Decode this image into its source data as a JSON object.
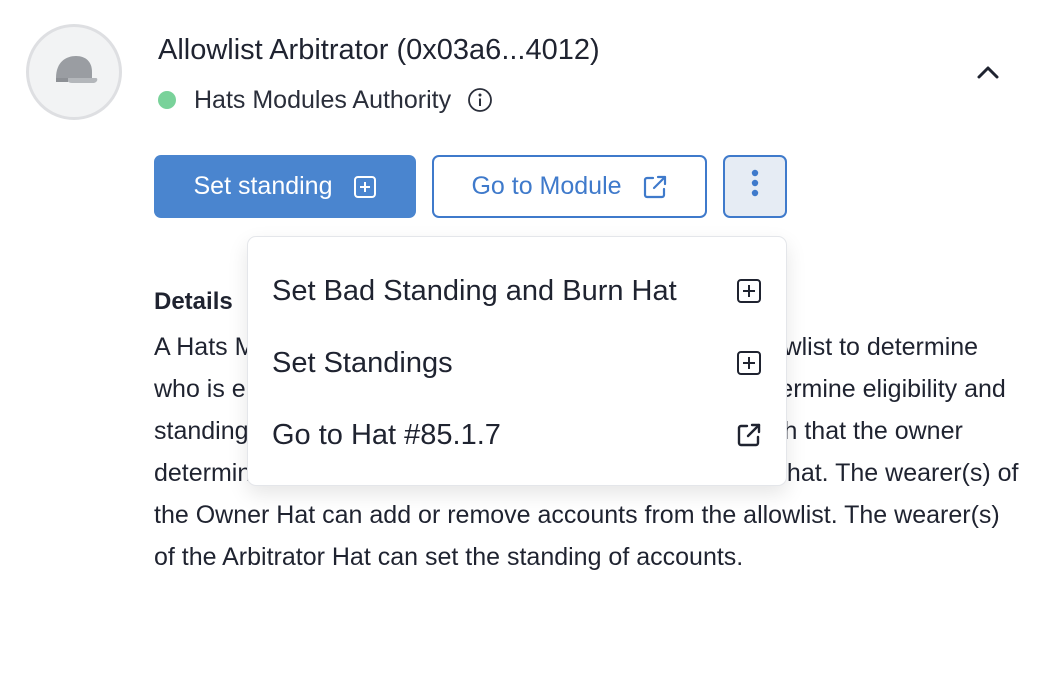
{
  "module": {
    "title": "Allowlist Arbitrator (0x03a6...4012)",
    "authority_label": "Hats Modules Authority",
    "status_color": "#79d29a"
  },
  "icons": {
    "avatar": "hat-icon",
    "info": "info-icon",
    "collapse": "chevron-up-icon",
    "set_standing": "plus-square-icon",
    "go_to_module": "external-link-icon",
    "more": "more-vertical-icon"
  },
  "actions": {
    "set_standing_label": "Set standing",
    "go_to_module_label": "Go to Module"
  },
  "menu": {
    "items": [
      {
        "label": "Set Bad Standing and Burn Hat",
        "icon": "plus-square-icon"
      },
      {
        "label": "Set Standings",
        "icon": "plus-square-icon"
      },
      {
        "label": "Go to Hat #85.1.7",
        "icon": "external-link-icon"
      }
    ]
  },
  "details": {
    "heading": "Details",
    "text": "A Hats Module that uses a standing arbitrator and an allowlist to determine who is eligible, where the wearer(s) of the allowlist to determine eligibility and standing for each account (i.e., potential hat wearer), such that the owner determines each account's eligibility and standing for the hat. The wearer(s) of the Owner Hat can add or remove accounts from the allowlist. The wearer(s) of the Arbitrator Hat can set the standing of accounts."
  },
  "colors": {
    "primary": "#4a85cf",
    "outline": "#3f7acb",
    "text": "#1f2330"
  }
}
